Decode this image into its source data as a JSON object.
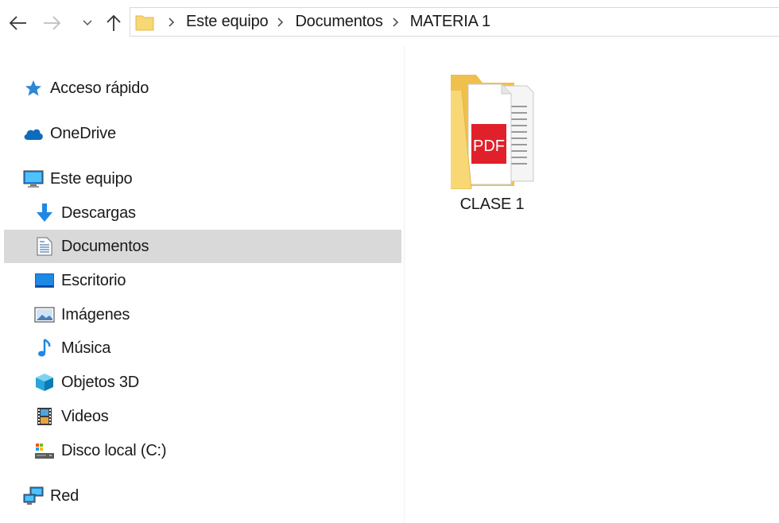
{
  "nav": {
    "back_icon": "arrow-left-icon",
    "forward_icon": "arrow-right-icon",
    "recent_icon": "chevron-down-icon",
    "up_icon": "arrow-up-icon"
  },
  "address": {
    "crumbs": [
      "Este equipo",
      "Documentos",
      "MATERIA 1"
    ]
  },
  "sidebar": {
    "items": [
      {
        "label": "Acceso rápido",
        "icon": "star-icon"
      },
      {
        "label": "OneDrive",
        "icon": "cloud-icon"
      },
      {
        "label": "Este equipo",
        "icon": "computer-icon"
      },
      {
        "label": "Descargas",
        "icon": "download-icon"
      },
      {
        "label": "Documentos",
        "icon": "documents-icon",
        "selected": true
      },
      {
        "label": "Escritorio",
        "icon": "desktop-icon"
      },
      {
        "label": "Imágenes",
        "icon": "pictures-icon"
      },
      {
        "label": "Música",
        "icon": "music-icon"
      },
      {
        "label": "Objetos 3D",
        "icon": "cube-icon"
      },
      {
        "label": "Videos",
        "icon": "video-icon"
      },
      {
        "label": "Disco local (C:)",
        "icon": "drive-icon"
      },
      {
        "label": "Red",
        "icon": "network-icon"
      }
    ]
  },
  "content": {
    "items": [
      {
        "label": "CLASE 1",
        "icon": "pdf-folder-icon",
        "badge": "PDF"
      }
    ]
  },
  "colors": {
    "selected_bg": "#d9d9d9",
    "folder_yellow": "#f8d775",
    "pdf_red": "#e0212b",
    "accent_blue": "#1e88e5"
  }
}
